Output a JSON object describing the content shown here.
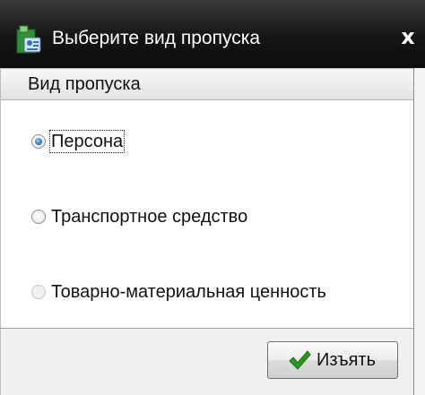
{
  "window": {
    "title": "Выберите вид пропуска",
    "close_label": "x"
  },
  "panel": {
    "header": "Вид пропуска",
    "options": [
      {
        "label": "Персона",
        "checked": true,
        "enabled": true
      },
      {
        "label": "Транспортное средство",
        "checked": false,
        "enabled": true
      },
      {
        "label": "Товарно-материальная ценность",
        "checked": false,
        "enabled": false
      }
    ]
  },
  "footer": {
    "withdraw_label": "Изъять"
  },
  "icons": {
    "app": "pass-card-icon",
    "close": "close-icon",
    "confirm": "checkmark-icon"
  },
  "colors": {
    "titlebar": "#151515",
    "radio_selected": "#2b78c9",
    "checkmark": "#2a9a1e"
  }
}
